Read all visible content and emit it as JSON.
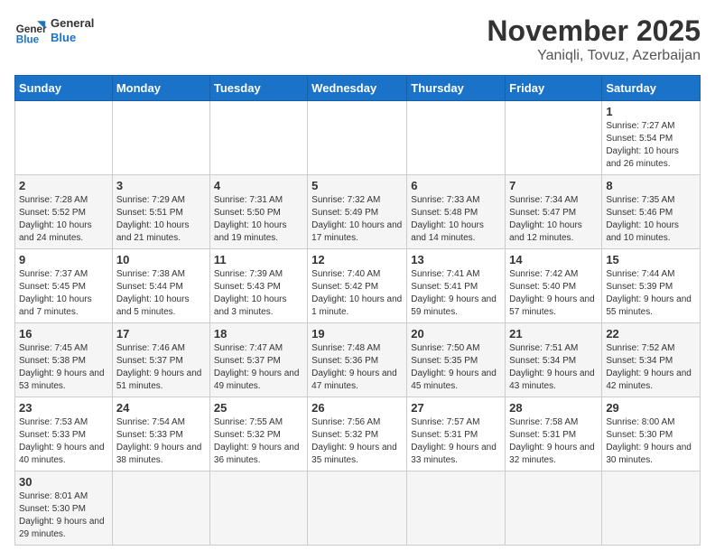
{
  "logo": {
    "general": "General",
    "blue": "Blue"
  },
  "header": {
    "month": "November 2025",
    "location": "Yaniqli, Tovuz, Azerbaijan"
  },
  "weekdays": [
    "Sunday",
    "Monday",
    "Tuesday",
    "Wednesday",
    "Thursday",
    "Friday",
    "Saturday"
  ],
  "weeks": [
    [
      {
        "day": "",
        "info": ""
      },
      {
        "day": "",
        "info": ""
      },
      {
        "day": "",
        "info": ""
      },
      {
        "day": "",
        "info": ""
      },
      {
        "day": "",
        "info": ""
      },
      {
        "day": "",
        "info": ""
      },
      {
        "day": "1",
        "info": "Sunrise: 7:27 AM\nSunset: 5:54 PM\nDaylight: 10 hours and 26 minutes."
      }
    ],
    [
      {
        "day": "2",
        "info": "Sunrise: 7:28 AM\nSunset: 5:52 PM\nDaylight: 10 hours and 24 minutes."
      },
      {
        "day": "3",
        "info": "Sunrise: 7:29 AM\nSunset: 5:51 PM\nDaylight: 10 hours and 21 minutes."
      },
      {
        "day": "4",
        "info": "Sunrise: 7:31 AM\nSunset: 5:50 PM\nDaylight: 10 hours and 19 minutes."
      },
      {
        "day": "5",
        "info": "Sunrise: 7:32 AM\nSunset: 5:49 PM\nDaylight: 10 hours and 17 minutes."
      },
      {
        "day": "6",
        "info": "Sunrise: 7:33 AM\nSunset: 5:48 PM\nDaylight: 10 hours and 14 minutes."
      },
      {
        "day": "7",
        "info": "Sunrise: 7:34 AM\nSunset: 5:47 PM\nDaylight: 10 hours and 12 minutes."
      },
      {
        "day": "8",
        "info": "Sunrise: 7:35 AM\nSunset: 5:46 PM\nDaylight: 10 hours and 10 minutes."
      }
    ],
    [
      {
        "day": "9",
        "info": "Sunrise: 7:37 AM\nSunset: 5:45 PM\nDaylight: 10 hours and 7 minutes."
      },
      {
        "day": "10",
        "info": "Sunrise: 7:38 AM\nSunset: 5:44 PM\nDaylight: 10 hours and 5 minutes."
      },
      {
        "day": "11",
        "info": "Sunrise: 7:39 AM\nSunset: 5:43 PM\nDaylight: 10 hours and 3 minutes."
      },
      {
        "day": "12",
        "info": "Sunrise: 7:40 AM\nSunset: 5:42 PM\nDaylight: 10 hours and 1 minute."
      },
      {
        "day": "13",
        "info": "Sunrise: 7:41 AM\nSunset: 5:41 PM\nDaylight: 9 hours and 59 minutes."
      },
      {
        "day": "14",
        "info": "Sunrise: 7:42 AM\nSunset: 5:40 PM\nDaylight: 9 hours and 57 minutes."
      },
      {
        "day": "15",
        "info": "Sunrise: 7:44 AM\nSunset: 5:39 PM\nDaylight: 9 hours and 55 minutes."
      }
    ],
    [
      {
        "day": "16",
        "info": "Sunrise: 7:45 AM\nSunset: 5:38 PM\nDaylight: 9 hours and 53 minutes."
      },
      {
        "day": "17",
        "info": "Sunrise: 7:46 AM\nSunset: 5:37 PM\nDaylight: 9 hours and 51 minutes."
      },
      {
        "day": "18",
        "info": "Sunrise: 7:47 AM\nSunset: 5:37 PM\nDaylight: 9 hours and 49 minutes."
      },
      {
        "day": "19",
        "info": "Sunrise: 7:48 AM\nSunset: 5:36 PM\nDaylight: 9 hours and 47 minutes."
      },
      {
        "day": "20",
        "info": "Sunrise: 7:50 AM\nSunset: 5:35 PM\nDaylight: 9 hours and 45 minutes."
      },
      {
        "day": "21",
        "info": "Sunrise: 7:51 AM\nSunset: 5:34 PM\nDaylight: 9 hours and 43 minutes."
      },
      {
        "day": "22",
        "info": "Sunrise: 7:52 AM\nSunset: 5:34 PM\nDaylight: 9 hours and 42 minutes."
      }
    ],
    [
      {
        "day": "23",
        "info": "Sunrise: 7:53 AM\nSunset: 5:33 PM\nDaylight: 9 hours and 40 minutes."
      },
      {
        "day": "24",
        "info": "Sunrise: 7:54 AM\nSunset: 5:33 PM\nDaylight: 9 hours and 38 minutes."
      },
      {
        "day": "25",
        "info": "Sunrise: 7:55 AM\nSunset: 5:32 PM\nDaylight: 9 hours and 36 minutes."
      },
      {
        "day": "26",
        "info": "Sunrise: 7:56 AM\nSunset: 5:32 PM\nDaylight: 9 hours and 35 minutes."
      },
      {
        "day": "27",
        "info": "Sunrise: 7:57 AM\nSunset: 5:31 PM\nDaylight: 9 hours and 33 minutes."
      },
      {
        "day": "28",
        "info": "Sunrise: 7:58 AM\nSunset: 5:31 PM\nDaylight: 9 hours and 32 minutes."
      },
      {
        "day": "29",
        "info": "Sunrise: 8:00 AM\nSunset: 5:30 PM\nDaylight: 9 hours and 30 minutes."
      }
    ],
    [
      {
        "day": "30",
        "info": "Sunrise: 8:01 AM\nSunset: 5:30 PM\nDaylight: 9 hours and 29 minutes."
      },
      {
        "day": "",
        "info": ""
      },
      {
        "day": "",
        "info": ""
      },
      {
        "day": "",
        "info": ""
      },
      {
        "day": "",
        "info": ""
      },
      {
        "day": "",
        "info": ""
      },
      {
        "day": "",
        "info": ""
      }
    ]
  ]
}
